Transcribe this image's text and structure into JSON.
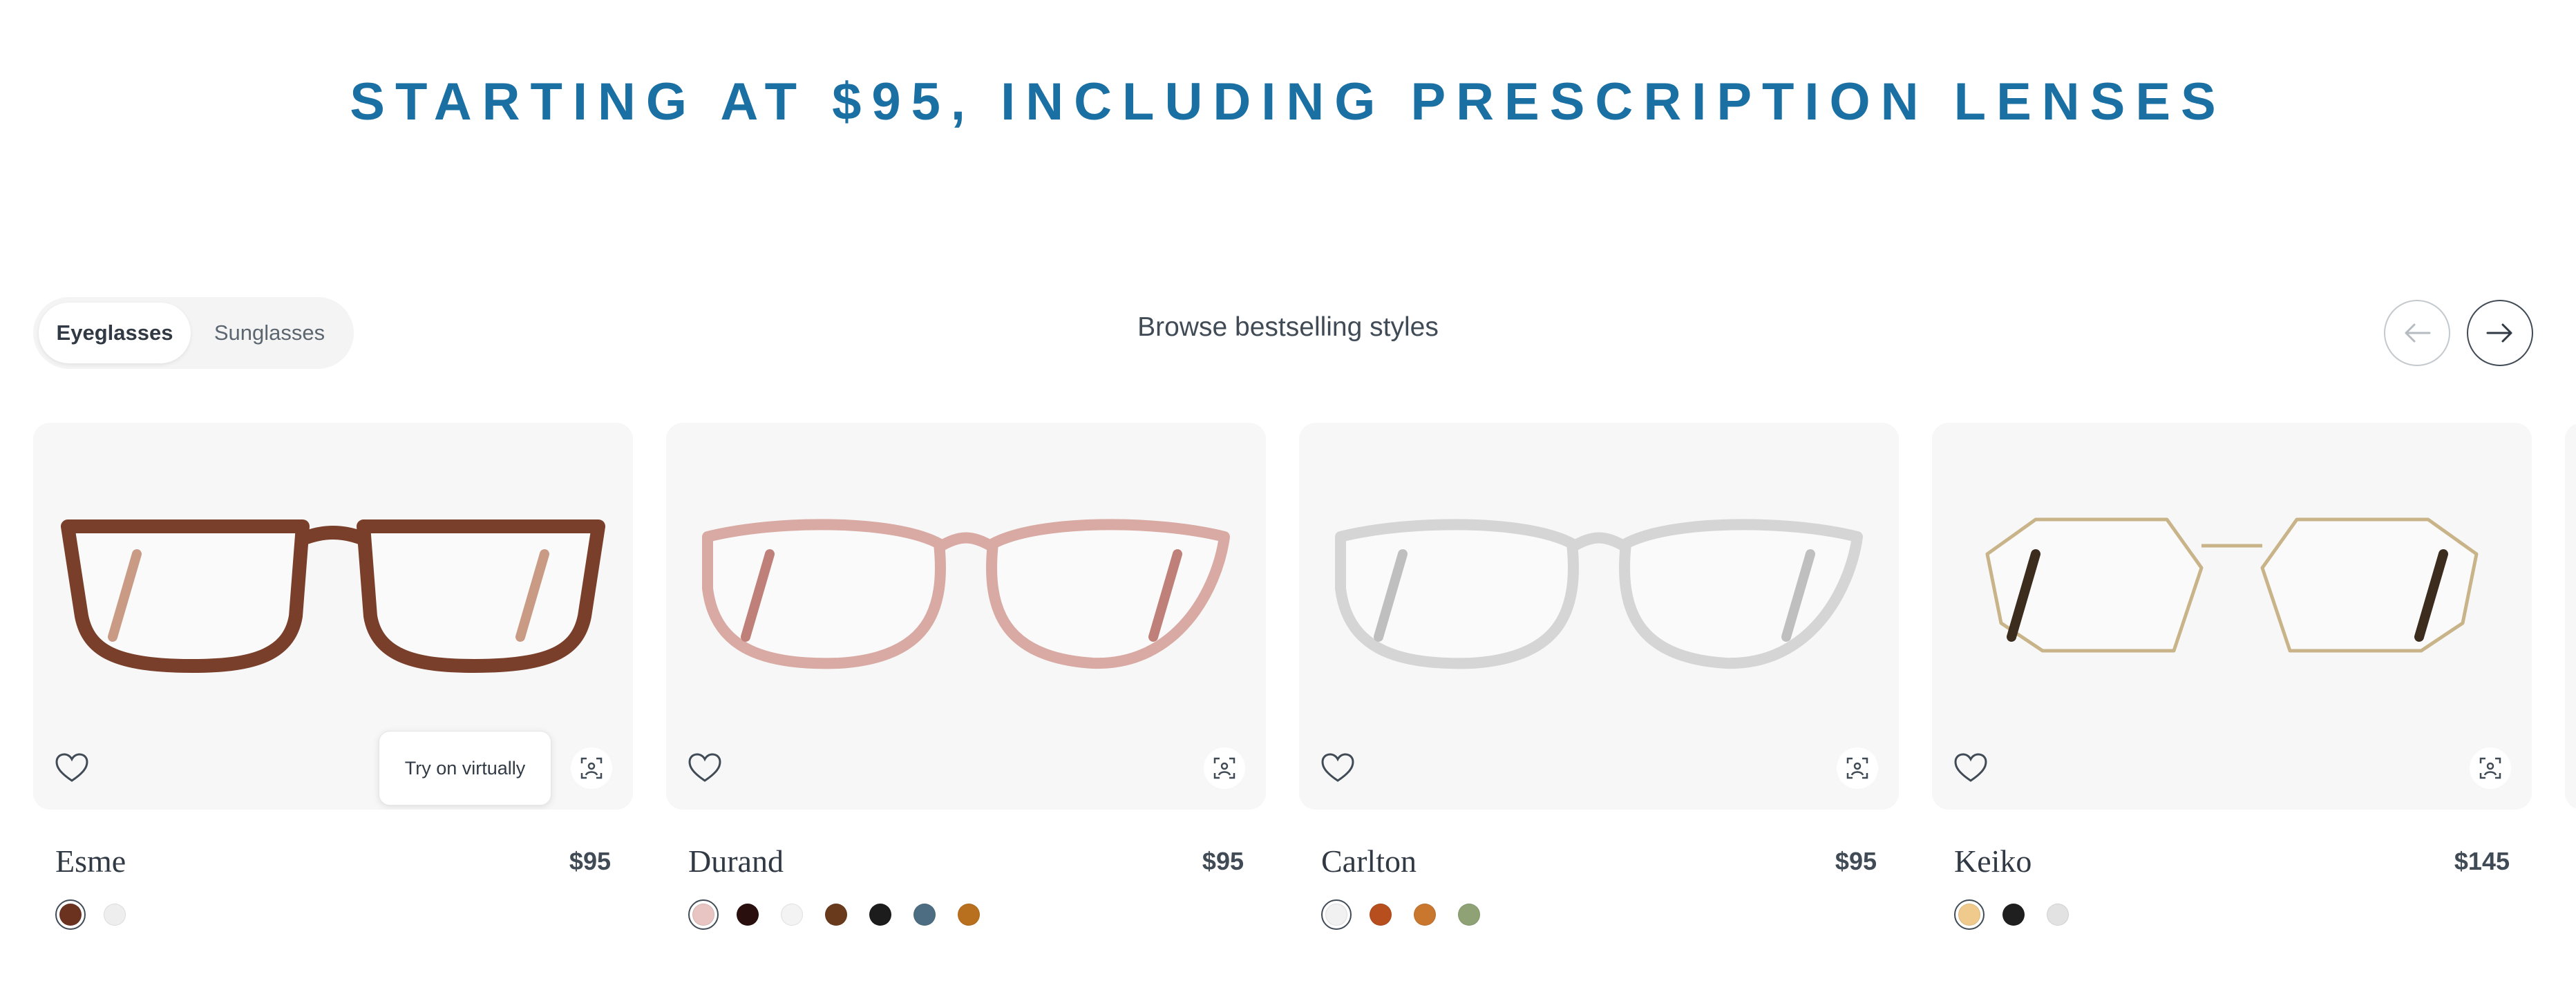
{
  "headline": "STARTING AT $95, INCLUDING PRESCRIPTION LENSES",
  "toggle": {
    "options": [
      "Eyeglasses",
      "Sunglasses"
    ],
    "selected": "Eyeglasses"
  },
  "browse_label": "Browse bestselling styles",
  "carousel": {
    "prev_icon": "arrow-left-icon",
    "next_icon": "arrow-right-icon"
  },
  "tooltip": "Try on virtually",
  "products": [
    {
      "name": "Esme",
      "price": "$95",
      "frame_color": "#7a3f2a",
      "frame_accent": "#c99a84",
      "swatches": [
        "#6b3220",
        "#eeeeee"
      ],
      "selected_swatch": 0
    },
    {
      "name": "Durand",
      "price": "$95",
      "frame_color": "#d9aaa3",
      "frame_accent": "#c0807a",
      "swatches": [
        "#e8c4c2",
        "#2a0f0f",
        "#f3f3f3",
        "#6a3a1c",
        "#1c1c1c",
        "#4d6e82",
        "#b8701e"
      ],
      "selected_swatch": 0
    },
    {
      "name": "Carlton",
      "price": "$95",
      "frame_color": "#d5d5d5",
      "frame_accent": "#bfbfbf",
      "swatches": [
        "#f1f1f1",
        "#b64e1d",
        "#c9772f",
        "#8ea276"
      ],
      "selected_swatch": 0
    },
    {
      "name": "Keiko",
      "price": "$145",
      "frame_color": "#c9b48a",
      "frame_accent": "#3b2c1e",
      "swatches": [
        "#f0c98c",
        "#1f1f1f",
        "#e2e2e2"
      ],
      "selected_swatch": 0
    }
  ]
}
